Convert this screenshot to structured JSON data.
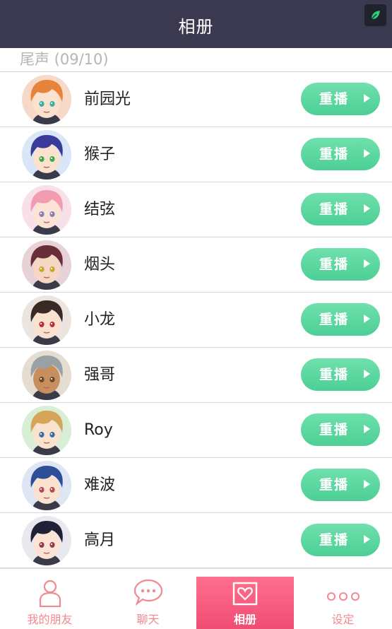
{
  "header": {
    "title": "相册"
  },
  "section": {
    "label": "尾声 (09/10)"
  },
  "replay_label": "重播",
  "items": [
    {
      "name": "前园光",
      "hair": "#e8833a",
      "eyes": "#38b0a6",
      "skin": "#fbe2cf",
      "bg": "#f7d9c8"
    },
    {
      "name": "猴子",
      "hair": "#3a3a9c",
      "eyes": "#3ea84c",
      "skin": "#fbe2cf",
      "bg": "#d9e6f7"
    },
    {
      "name": "结弦",
      "hair": "#f29bb1",
      "eyes": "#8a7db8",
      "skin": "#fbe4d6",
      "bg": "#f7e0e8"
    },
    {
      "name": "烟头",
      "hair": "#6a2e3a",
      "eyes": "#c9a634",
      "skin": "#f5d7c3",
      "bg": "#e7d2d7"
    },
    {
      "name": "小龙",
      "hair": "#3a2a26",
      "eyes": "#b8323e",
      "skin": "#fbe2cf",
      "bg": "#ece4de"
    },
    {
      "name": "强哥",
      "hair": "#9aa1a6",
      "eyes": "#6b4a2a",
      "skin": "#c98e5e",
      "bg": "#e6ddd2"
    },
    {
      "name": "Roy",
      "hair": "#d7a55a",
      "eyes": "#3a6ea8",
      "skin": "#fbe2cf",
      "bg": "#d9efd5"
    },
    {
      "name": "难波",
      "hair": "#2f4e9a",
      "eyes": "#b24a5a",
      "skin": "#fbe2cf",
      "bg": "#dfe6f3"
    },
    {
      "name": "高月",
      "hair": "#1f2236",
      "eyes": "#9a3a4a",
      "skin": "#fbe4d6",
      "bg": "#e8e8ee"
    }
  ],
  "nav": [
    {
      "label": "我的朋友",
      "icon": "person-icon",
      "active": false
    },
    {
      "label": "聊天",
      "icon": "chat-bubble-icon",
      "active": false
    },
    {
      "label": "相册",
      "icon": "heart-frame-icon",
      "active": true
    },
    {
      "label": "设定",
      "icon": "three-dots-icon",
      "active": false
    }
  ],
  "colors": {
    "header_bg": "#3b3950",
    "replay_green": "#4ccf95",
    "nav_pink": "#f2898f",
    "nav_active": "#f04c73"
  }
}
